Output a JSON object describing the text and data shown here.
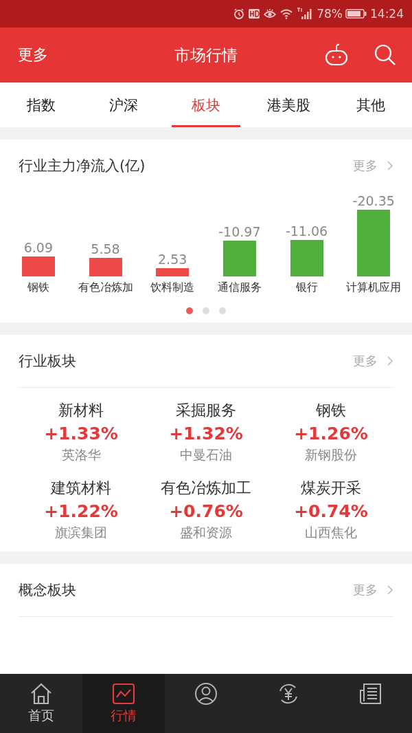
{
  "status_bar": {
    "battery": "78%",
    "time": "14:24"
  },
  "header": {
    "left": "更多",
    "title": "市场行情"
  },
  "tabs": [
    {
      "label": "指数",
      "selected": false
    },
    {
      "label": "沪深",
      "selected": false
    },
    {
      "label": "板块",
      "selected": true
    },
    {
      "label": "港美股",
      "selected": false
    },
    {
      "label": "其他",
      "selected": false
    }
  ],
  "fund_flow": {
    "title": "行业主力净流入(亿)",
    "more": "更多",
    "flows": [
      {
        "sector": "钢铁",
        "value": "6.09"
      },
      {
        "sector": "有色冶炼加",
        "value": "5.58"
      },
      {
        "sector": "饮料制造",
        "value": "2.53"
      },
      {
        "sector": "通信服务",
        "value": "-10.97"
      },
      {
        "sector": "银行",
        "value": "-11.06"
      },
      {
        "sector": "计算机应用",
        "value": "-20.35"
      }
    ],
    "pages": [
      {
        "selected": true
      },
      {
        "selected": false
      },
      {
        "selected": false
      }
    ]
  },
  "industry": {
    "title": "行业板块",
    "more": "更多",
    "items": [
      {
        "name": "新材料",
        "change": "+1.33%",
        "leader": "英洛华"
      },
      {
        "name": "采掘服务",
        "change": "+1.32%",
        "leader": "中曼石油"
      },
      {
        "name": "钢铁",
        "change": "+1.26%",
        "leader": "新钢股份"
      },
      {
        "name": "建筑材料",
        "change": "+1.22%",
        "leader": "旗滨集团"
      },
      {
        "name": "有色冶炼加工",
        "change": "+0.76%",
        "leader": "盛和资源"
      },
      {
        "name": "煤炭开采",
        "change": "+0.74%",
        "leader": "山西焦化"
      }
    ]
  },
  "concept": {
    "title": "概念板块",
    "more": "更多"
  },
  "bottom_nav": [
    {
      "kind": "home",
      "label": "首页",
      "selected": false
    },
    {
      "kind": "chart",
      "label": "行情",
      "selected": true
    },
    {
      "kind": "person",
      "selected": false
    },
    {
      "kind": "yuan",
      "selected": false
    },
    {
      "kind": "news",
      "selected": false
    }
  ]
}
